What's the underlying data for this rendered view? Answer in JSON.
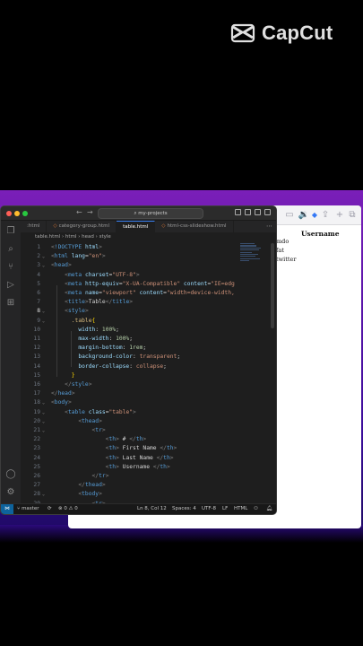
{
  "watermark": {
    "brand": "CapCut"
  },
  "browser": {
    "table_header": "Username",
    "rows": [
      "mdo",
      "fat",
      "twitter"
    ]
  },
  "vscode": {
    "search_text": "my-projects",
    "tabs": [
      {
        "label": ":html",
        "active": false
      },
      {
        "label": "category-group.html",
        "active": false
      },
      {
        "label": "table.html",
        "active": true
      },
      {
        "label": "html-css-slideshow.html",
        "active": false
      }
    ],
    "breadcrumb": [
      "table.html",
      "html",
      "head",
      "style"
    ],
    "code_lines": [
      {
        "n": "1",
        "tokens": [
          [
            "c-punc",
            "<"
          ],
          [
            "c-tag",
            "!DOCTYPE"
          ],
          [
            "c-text",
            " "
          ],
          [
            "c-attr",
            "html"
          ],
          [
            "c-punc",
            ">"
          ]
        ]
      },
      {
        "n": "2",
        "tokens": [
          [
            "c-punc",
            "<"
          ],
          [
            "c-tag",
            "html"
          ],
          [
            "c-text",
            " "
          ],
          [
            "c-attr",
            "lang"
          ],
          [
            "c-text",
            "="
          ],
          [
            "c-str",
            "\"en\""
          ],
          [
            "c-punc",
            ">"
          ]
        ]
      },
      {
        "n": "3",
        "tokens": [
          [
            "c-punc",
            "<"
          ],
          [
            "c-tag",
            "head"
          ],
          [
            "c-punc",
            ">"
          ]
        ]
      },
      {
        "n": "4",
        "tokens": [
          [
            "c-text",
            "    "
          ],
          [
            "c-punc",
            "<"
          ],
          [
            "c-tag",
            "meta"
          ],
          [
            "c-text",
            " "
          ],
          [
            "c-attr",
            "charset"
          ],
          [
            "c-text",
            "="
          ],
          [
            "c-str",
            "\"UTF-8\""
          ],
          [
            "c-punc",
            ">"
          ]
        ]
      },
      {
        "n": "5",
        "tokens": [
          [
            "c-text",
            "    "
          ],
          [
            "c-punc",
            "<"
          ],
          [
            "c-tag",
            "meta"
          ],
          [
            "c-text",
            " "
          ],
          [
            "c-attr",
            "http-equiv"
          ],
          [
            "c-text",
            "="
          ],
          [
            "c-str",
            "\"X-UA-Compatible\""
          ],
          [
            "c-text",
            " "
          ],
          [
            "c-attr",
            "content"
          ],
          [
            "c-text",
            "="
          ],
          [
            "c-str",
            "\"IE=edg"
          ]
        ]
      },
      {
        "n": "6",
        "tokens": [
          [
            "c-text",
            "    "
          ],
          [
            "c-punc",
            "<"
          ],
          [
            "c-tag",
            "meta"
          ],
          [
            "c-text",
            " "
          ],
          [
            "c-attr",
            "name"
          ],
          [
            "c-text",
            "="
          ],
          [
            "c-str",
            "\"viewport\""
          ],
          [
            "c-text",
            " "
          ],
          [
            "c-attr",
            "content"
          ],
          [
            "c-text",
            "="
          ],
          [
            "c-str",
            "\"width=device-width,"
          ]
        ]
      },
      {
        "n": "7",
        "tokens": [
          [
            "c-text",
            "    "
          ],
          [
            "c-punc",
            "<"
          ],
          [
            "c-tag",
            "title"
          ],
          [
            "c-punc",
            ">"
          ],
          [
            "c-text",
            "Table"
          ],
          [
            "c-punc",
            "</"
          ],
          [
            "c-tag",
            "title"
          ],
          [
            "c-punc",
            ">"
          ]
        ]
      },
      {
        "n": "8",
        "tokens": [
          [
            "c-text",
            "    "
          ],
          [
            "c-punc",
            "<"
          ],
          [
            "c-tag",
            "style"
          ],
          [
            "c-punc",
            ">"
          ]
        ]
      },
      {
        "n": "9",
        "tokens": [
          [
            "c-text",
            "      "
          ],
          [
            "c-sel",
            ".table"
          ],
          [
            "c-brace",
            "{"
          ]
        ]
      },
      {
        "n": "10",
        "tokens": [
          [
            "c-text",
            "        "
          ],
          [
            "c-prop",
            "width"
          ],
          [
            "c-text",
            ": "
          ],
          [
            "c-num",
            "100%"
          ],
          [
            "c-text",
            ";"
          ]
        ]
      },
      {
        "n": "11",
        "tokens": [
          [
            "c-text",
            "        "
          ],
          [
            "c-prop",
            "max-width"
          ],
          [
            "c-text",
            ": "
          ],
          [
            "c-num",
            "100%"
          ],
          [
            "c-text",
            ";"
          ]
        ]
      },
      {
        "n": "12",
        "tokens": [
          [
            "c-text",
            "        "
          ],
          [
            "c-prop",
            "margin-bottom"
          ],
          [
            "c-text",
            ": "
          ],
          [
            "c-num",
            "1rem"
          ],
          [
            "c-text",
            ";"
          ]
        ]
      },
      {
        "n": "13",
        "tokens": [
          [
            "c-text",
            "        "
          ],
          [
            "c-prop",
            "background-color"
          ],
          [
            "c-text",
            ": "
          ],
          [
            "c-val",
            "transparent"
          ],
          [
            "c-text",
            ";"
          ]
        ]
      },
      {
        "n": "14",
        "tokens": [
          [
            "c-text",
            "        "
          ],
          [
            "c-prop",
            "border-collapse"
          ],
          [
            "c-text",
            ": "
          ],
          [
            "c-val",
            "collapse"
          ],
          [
            "c-text",
            ";"
          ]
        ]
      },
      {
        "n": "15",
        "tokens": [
          [
            "c-text",
            "      "
          ],
          [
            "c-brace",
            "}"
          ]
        ]
      },
      {
        "n": "16",
        "tokens": [
          [
            "c-text",
            "    "
          ],
          [
            "c-punc",
            "</"
          ],
          [
            "c-tag",
            "style"
          ],
          [
            "c-punc",
            ">"
          ]
        ]
      },
      {
        "n": "17",
        "tokens": [
          [
            "c-punc",
            "</"
          ],
          [
            "c-tag",
            "head"
          ],
          [
            "c-punc",
            ">"
          ]
        ]
      },
      {
        "n": "18",
        "tokens": [
          [
            "c-punc",
            "<"
          ],
          [
            "c-tag",
            "body"
          ],
          [
            "c-punc",
            ">"
          ]
        ]
      },
      {
        "n": "19",
        "tokens": [
          [
            "c-text",
            "    "
          ],
          [
            "c-punc",
            "<"
          ],
          [
            "c-tag",
            "table"
          ],
          [
            "c-text",
            " "
          ],
          [
            "c-attr",
            "class"
          ],
          [
            "c-text",
            "="
          ],
          [
            "c-str",
            "\"table\""
          ],
          [
            "c-punc",
            ">"
          ]
        ]
      },
      {
        "n": "20",
        "tokens": [
          [
            "c-text",
            "        "
          ],
          [
            "c-punc",
            "<"
          ],
          [
            "c-tag",
            "thead"
          ],
          [
            "c-punc",
            ">"
          ]
        ]
      },
      {
        "n": "21",
        "tokens": [
          [
            "c-text",
            "            "
          ],
          [
            "c-punc",
            "<"
          ],
          [
            "c-tag",
            "tr"
          ],
          [
            "c-punc",
            ">"
          ]
        ]
      },
      {
        "n": "22",
        "tokens": [
          [
            "c-text",
            "                "
          ],
          [
            "c-punc",
            "<"
          ],
          [
            "c-tag",
            "th"
          ],
          [
            "c-punc",
            ">"
          ],
          [
            "c-text",
            " # "
          ],
          [
            "c-punc",
            "</"
          ],
          [
            "c-tag",
            "th"
          ],
          [
            "c-punc",
            ">"
          ]
        ]
      },
      {
        "n": "23",
        "tokens": [
          [
            "c-text",
            "                "
          ],
          [
            "c-punc",
            "<"
          ],
          [
            "c-tag",
            "th"
          ],
          [
            "c-punc",
            ">"
          ],
          [
            "c-text",
            " First Name "
          ],
          [
            "c-punc",
            "</"
          ],
          [
            "c-tag",
            "th"
          ],
          [
            "c-punc",
            ">"
          ]
        ]
      },
      {
        "n": "24",
        "tokens": [
          [
            "c-text",
            "                "
          ],
          [
            "c-punc",
            "<"
          ],
          [
            "c-tag",
            "th"
          ],
          [
            "c-punc",
            ">"
          ],
          [
            "c-text",
            " Last Name "
          ],
          [
            "c-punc",
            "</"
          ],
          [
            "c-tag",
            "th"
          ],
          [
            "c-punc",
            ">"
          ]
        ]
      },
      {
        "n": "25",
        "tokens": [
          [
            "c-text",
            "                "
          ],
          [
            "c-punc",
            "<"
          ],
          [
            "c-tag",
            "th"
          ],
          [
            "c-punc",
            ">"
          ],
          [
            "c-text",
            " Username "
          ],
          [
            "c-punc",
            "</"
          ],
          [
            "c-tag",
            "th"
          ],
          [
            "c-punc",
            ">"
          ]
        ]
      },
      {
        "n": "26",
        "tokens": [
          [
            "c-text",
            "            "
          ],
          [
            "c-punc",
            "</"
          ],
          [
            "c-tag",
            "tr"
          ],
          [
            "c-punc",
            ">"
          ]
        ]
      },
      {
        "n": "27",
        "tokens": [
          [
            "c-text",
            "        "
          ],
          [
            "c-punc",
            "</"
          ],
          [
            "c-tag",
            "thead"
          ],
          [
            "c-punc",
            ">"
          ]
        ]
      },
      {
        "n": "28",
        "tokens": [
          [
            "c-text",
            "        "
          ],
          [
            "c-punc",
            "<"
          ],
          [
            "c-tag",
            "tbody"
          ],
          [
            "c-punc",
            ">"
          ]
        ]
      },
      {
        "n": "29",
        "tokens": [
          [
            "c-text",
            "            "
          ],
          [
            "c-punc",
            "<"
          ],
          [
            "c-tag",
            "tr"
          ],
          [
            "c-punc",
            ">"
          ]
        ]
      }
    ],
    "current_line": "8",
    "status": {
      "branch": "master",
      "errors": "0",
      "warnings": "0",
      "position": "Ln 8, Col 12",
      "spaces": "Spaces: 4",
      "encoding": "UTF-8",
      "eol": "LF",
      "language": "HTML"
    }
  }
}
